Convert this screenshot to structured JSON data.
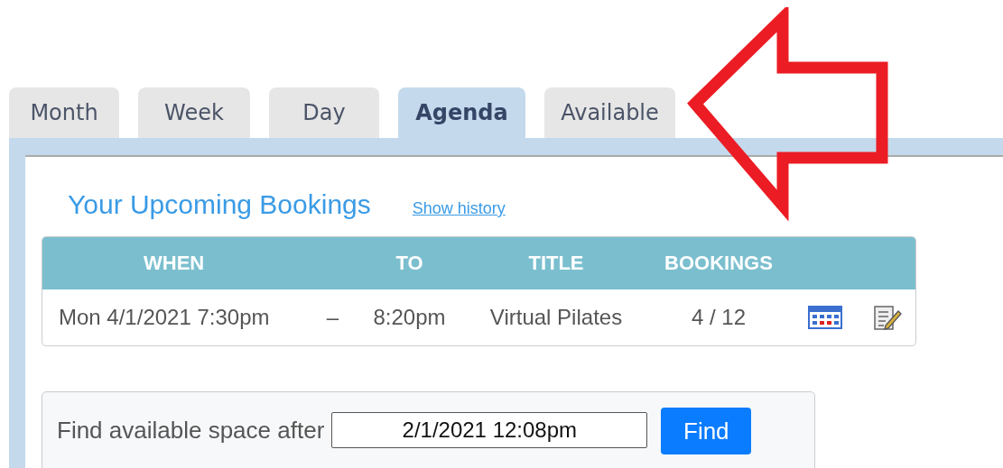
{
  "tabs": [
    {
      "label": "Month",
      "selected": false
    },
    {
      "label": "Week",
      "selected": false
    },
    {
      "label": "Day",
      "selected": false
    },
    {
      "label": "Agenda",
      "selected": true
    },
    {
      "label": "Available",
      "selected": false
    }
  ],
  "bookings": {
    "title": "Your Upcoming Bookings",
    "history_link": "Show history",
    "columns": [
      "WHEN",
      "TO",
      "TITLE",
      "BOOKINGS"
    ],
    "rows": [
      {
        "when": "Mon 4/1/2021 7:30pm",
        "separator": "–",
        "to": "8:20pm",
        "title": "Virtual Pilates",
        "bookings": "4 / 12"
      }
    ]
  },
  "find": {
    "label": "Find available space after",
    "value": "2/1/2021 12:08pm",
    "button": "Find"
  }
}
